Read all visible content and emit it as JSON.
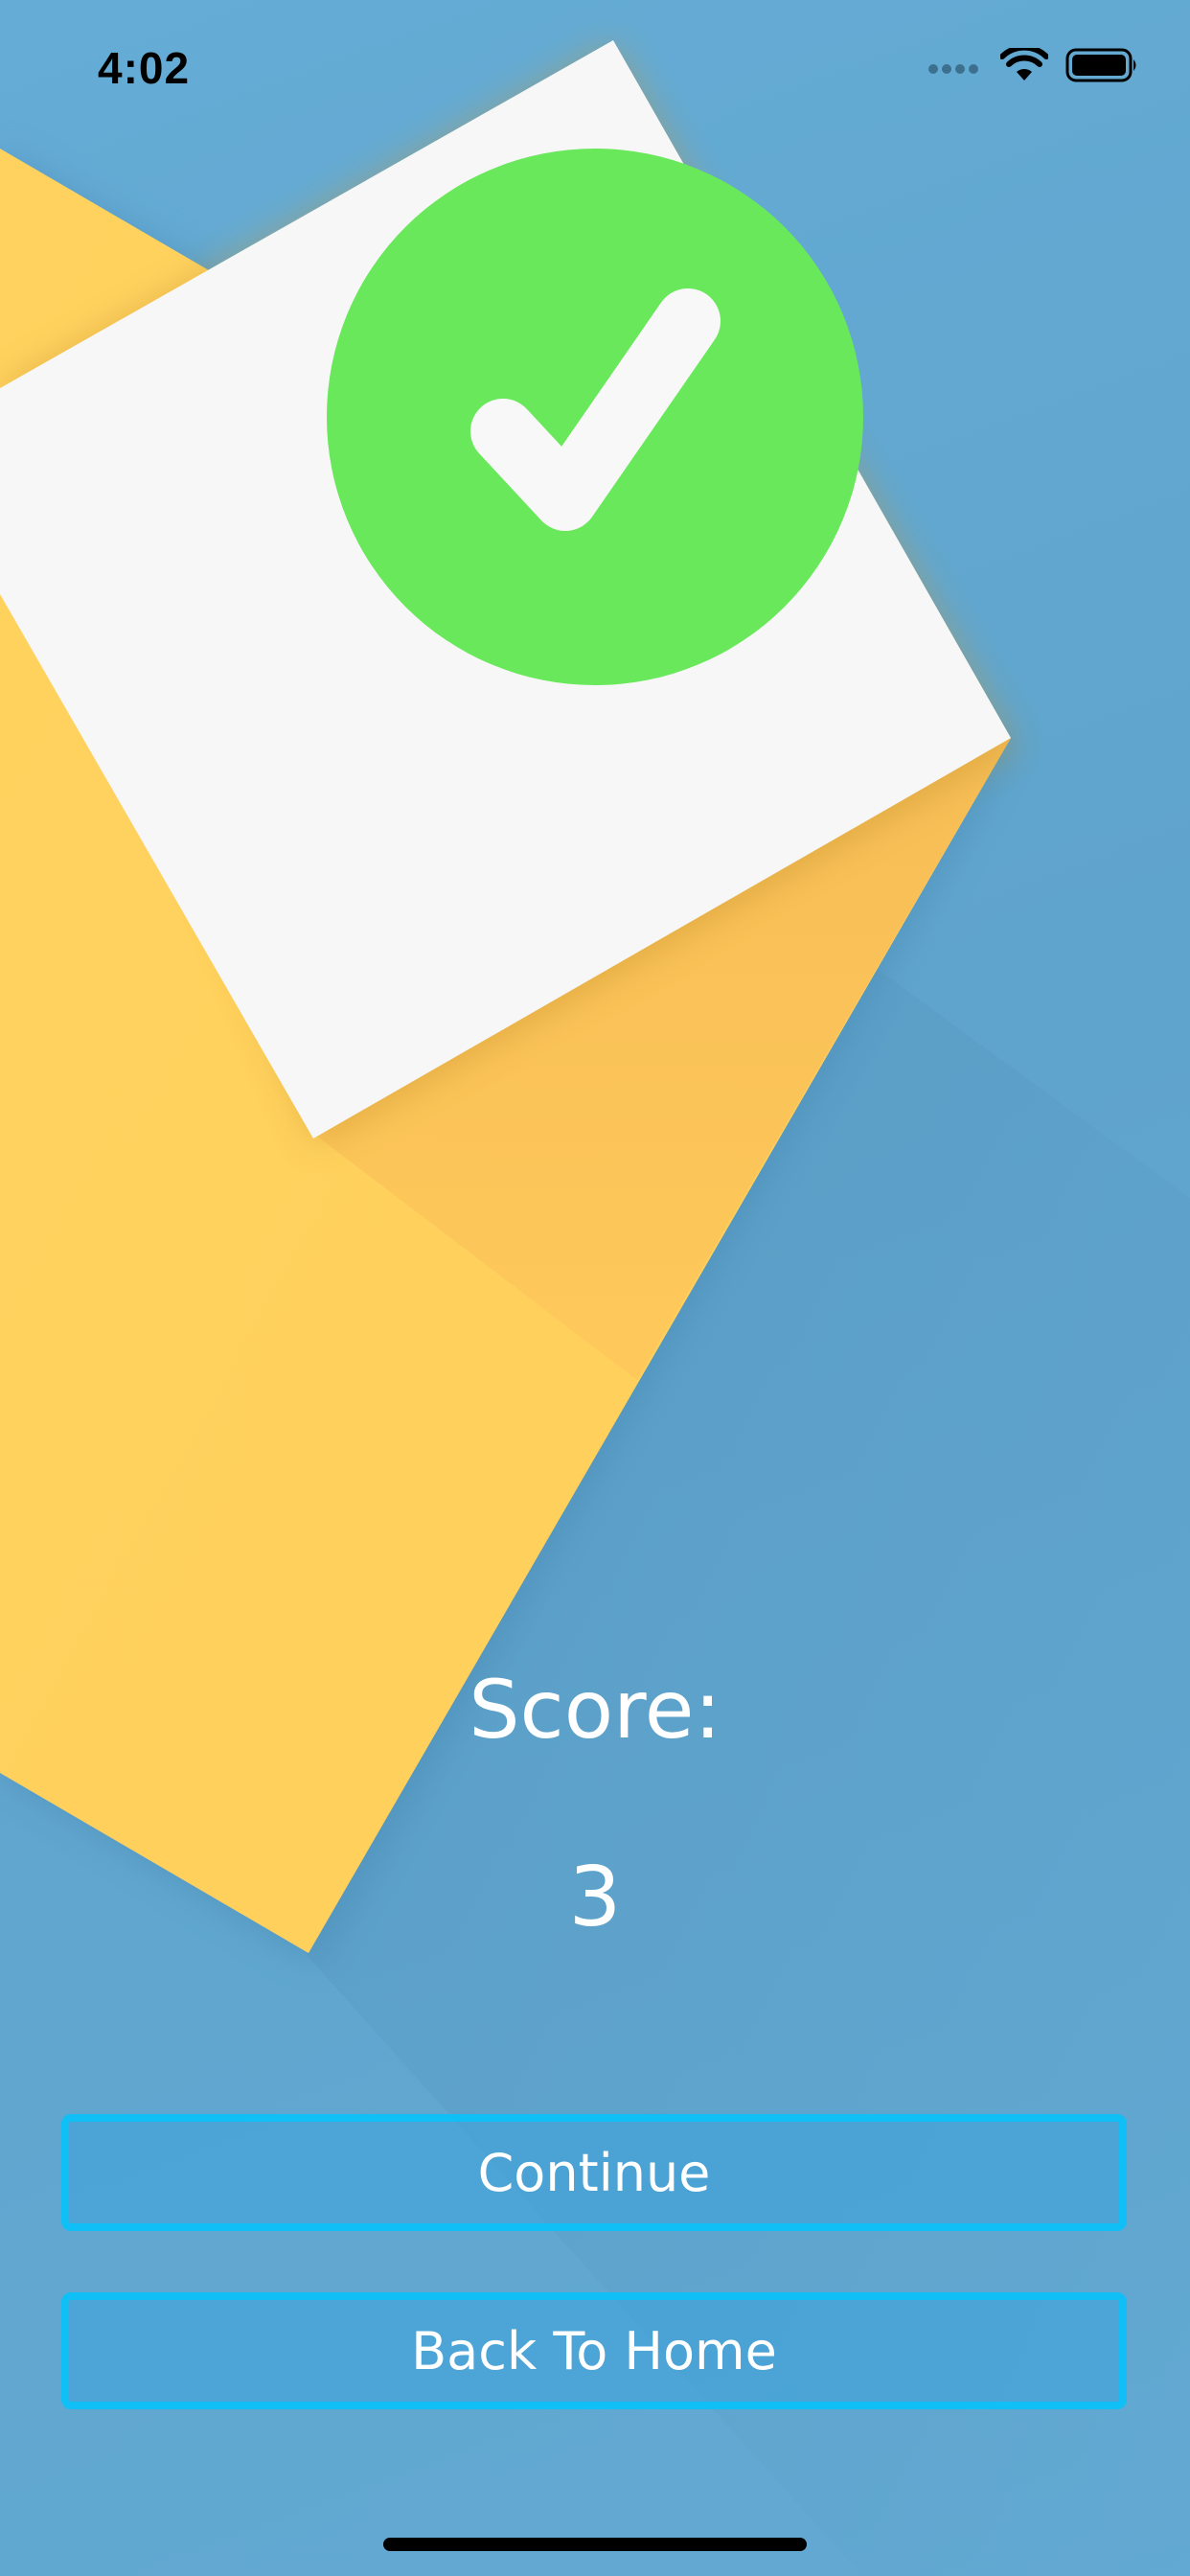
{
  "status_bar": {
    "time": "4:02",
    "signal_icon": "cellular-signal-icon",
    "wifi_icon": "wifi-icon",
    "battery_icon": "battery-icon"
  },
  "result": {
    "icon": "checkmark-circle-icon",
    "check_color": "#68e85a",
    "score_label": "Score:",
    "score_value": "3"
  },
  "actions": {
    "continue_label": "Continue",
    "home_label": "Back To Home",
    "border_color": "#10bff5"
  },
  "colors": {
    "background": "#62a9d3",
    "card_yellow": "#ffd15c",
    "card_white": "#f7f7f7"
  }
}
